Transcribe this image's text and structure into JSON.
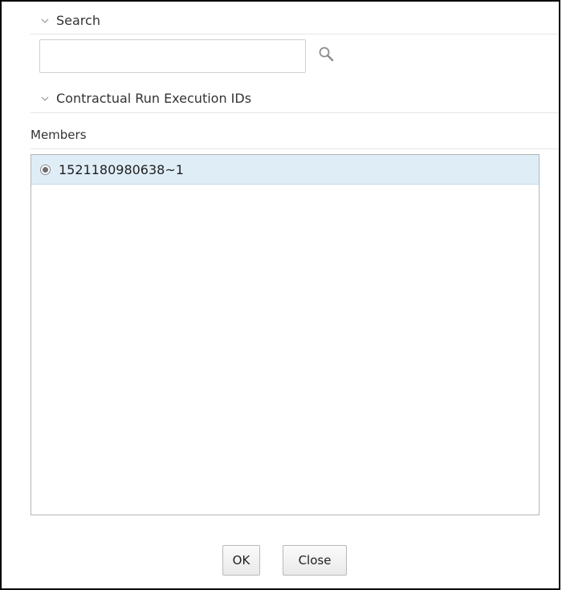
{
  "search": {
    "header_label": "Search",
    "input_value": "",
    "input_placeholder": ""
  },
  "run_ids": {
    "header_label": "Contractual Run Execution IDs",
    "members_label": "Members",
    "items": [
      {
        "label": "1521180980638~1",
        "selected": true
      }
    ]
  },
  "footer": {
    "ok_label": "OK",
    "close_label": "Close"
  },
  "colors": {
    "selected_row_bg": "#dfedf7",
    "border": "#b5b5b5",
    "text": "#333333"
  },
  "icons": {
    "search": "search-icon",
    "chevron": "chevron-down-icon",
    "radio": "radio-selected-icon"
  }
}
